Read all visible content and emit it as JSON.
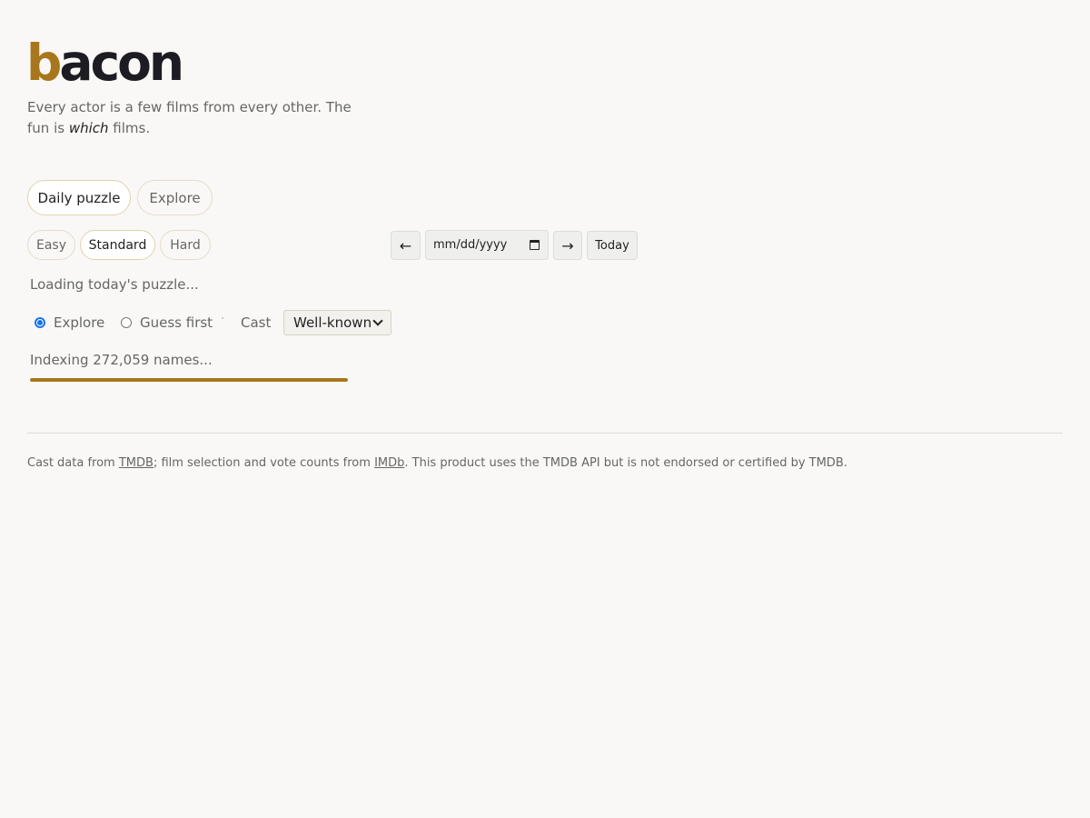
{
  "header": {
    "logo_accent": "b",
    "logo_rest": "acon",
    "tagline_before": "Every actor is a few films from every other. The fun is ",
    "tagline_emph": "which",
    "tagline_after": " films."
  },
  "mode_tabs": [
    {
      "label": "Daily puzzle",
      "active": true
    },
    {
      "label": "Explore",
      "active": false
    }
  ],
  "difficulty": [
    {
      "label": "Easy",
      "active": false
    },
    {
      "label": "Standard",
      "active": true
    },
    {
      "label": "Hard",
      "active": false
    }
  ],
  "date_nav": {
    "prev_label": "←",
    "date_placeholder": "mm/dd/yyyy",
    "next_label": "→",
    "today_label": "Today",
    "calendar_icon": "calendar-icon"
  },
  "status": {
    "loading": "Loading today's puzzle..."
  },
  "play_mode": {
    "options": [
      {
        "label": "Explore",
        "checked": true
      },
      {
        "label": "Guess first",
        "checked": false
      }
    ],
    "cast_label": "Cast",
    "cast_selected": "Well-known"
  },
  "indexing": {
    "text": "Indexing 272,059 names...",
    "progress": 1.0
  },
  "footer": {
    "before_tmdb": "Cast data from ",
    "tmdb_link": "TMDB",
    "middle": "; film selection and vote counts from ",
    "imdb_link": "IMDb",
    "after": ". This product uses the TMDB API but is not endorsed or certified by TMDB."
  },
  "colors": {
    "accent": "#a8771d",
    "background": "#f9f8f6",
    "radio_blue": "#1a73e8"
  }
}
